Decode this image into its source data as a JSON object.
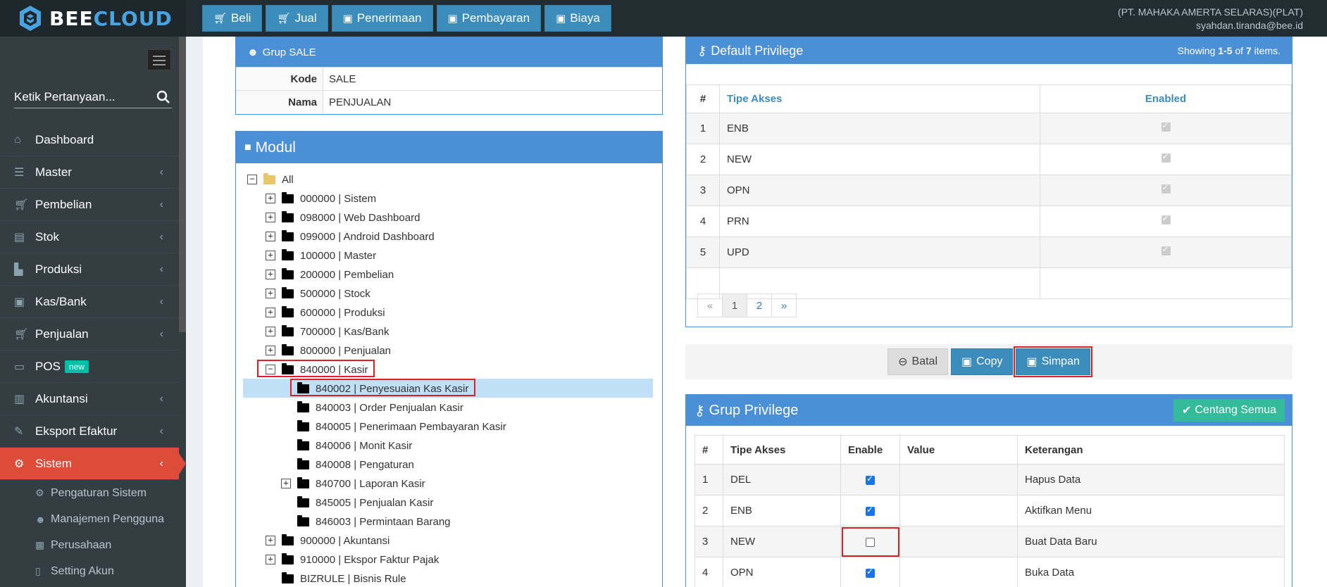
{
  "app": {
    "brand_bee": "BEE",
    "brand_cloud": "CLOUD",
    "company": "(PT. MAHAKA AMERTA SELARAS)(PLAT)",
    "user": "syahdan.tiranda@bee.id"
  },
  "topnav": [
    {
      "label": "Beli",
      "icon": "cart-icon"
    },
    {
      "label": "Jual",
      "icon": "cart-icon"
    },
    {
      "label": "Penerimaan",
      "icon": "money-icon"
    },
    {
      "label": "Pembayaran",
      "icon": "money-icon"
    },
    {
      "label": "Biaya",
      "icon": "money-icon"
    }
  ],
  "sidebar": {
    "search_placeholder": "Ketik Pertanyaan...",
    "items": [
      {
        "label": "Dashboard",
        "icon": "home-icon"
      },
      {
        "label": "Master",
        "icon": "database-icon"
      },
      {
        "label": "Pembelian",
        "icon": "cart-icon"
      },
      {
        "label": "Stok",
        "icon": "box-icon"
      },
      {
        "label": "Produksi",
        "icon": "industry-icon"
      },
      {
        "label": "Kas/Bank",
        "icon": "money-icon"
      },
      {
        "label": "Penjualan",
        "icon": "cart-icon"
      },
      {
        "label": "POS",
        "icon": "desktop-icon",
        "badge": "new"
      },
      {
        "label": "Akuntansi",
        "icon": "chart-icon"
      },
      {
        "label": "Eksport Efaktur",
        "icon": "edit-icon"
      },
      {
        "label": "Sistem",
        "icon": "cogs-icon"
      }
    ],
    "subitems": [
      {
        "label": "Pengaturan Sistem",
        "icon": "gear-icon"
      },
      {
        "label": "Manajemen Pengguna",
        "icon": "users-icon"
      },
      {
        "label": "Perusahaan",
        "icon": "building-icon"
      },
      {
        "label": "Setting Akun",
        "icon": "file-icon"
      }
    ]
  },
  "grup": {
    "title": "Grup SALE",
    "kode_label": "Kode",
    "kode_value": "SALE",
    "nama_label": "Nama",
    "nama_value": "PENJUALAN"
  },
  "modul": {
    "title": "Modul",
    "tree": [
      {
        "label": "All",
        "level": 0,
        "toggle": "−",
        "folder": "yellow"
      },
      {
        "label": "000000 | Sistem",
        "level": 1,
        "toggle": "+"
      },
      {
        "label": "098000 | Web Dashboard",
        "level": 1,
        "toggle": "+"
      },
      {
        "label": "099000 | Android Dashboard",
        "level": 1,
        "toggle": "+"
      },
      {
        "label": "100000 | Master",
        "level": 1,
        "toggle": "+"
      },
      {
        "label": "200000 | Pembelian",
        "level": 1,
        "toggle": "+"
      },
      {
        "label": "500000 | Stock",
        "level": 1,
        "toggle": "+"
      },
      {
        "label": "600000 | Produksi",
        "level": 1,
        "toggle": "+"
      },
      {
        "label": "700000 | Kas/Bank",
        "level": 1,
        "toggle": "+"
      },
      {
        "label": "800000 | Penjualan",
        "level": 1,
        "toggle": "+"
      },
      {
        "label": "840000 | Kasir",
        "level": 1,
        "toggle": "−",
        "open": true
      },
      {
        "label": "840002 | Penyesuaian Kas Kasir",
        "level": 2,
        "selected": true
      },
      {
        "label": "840003 | Order Penjualan Kasir",
        "level": 2
      },
      {
        "label": "840005 | Penerimaan Pembayaran Kasir",
        "level": 2
      },
      {
        "label": "840006 | Monit Kasir",
        "level": 2
      },
      {
        "label": "840008 | Pengaturan",
        "level": 2
      },
      {
        "label": "840700 | Laporan Kasir",
        "level": 2,
        "toggle": "+"
      },
      {
        "label": "845005 | Penjualan Kasir",
        "level": 2
      },
      {
        "label": "846003 | Permintaan Barang",
        "level": 2
      },
      {
        "label": "900000 | Akuntansi",
        "level": 1,
        "toggle": "+"
      },
      {
        "label": "910000 | Ekspor Faktur Pajak",
        "level": 1,
        "toggle": "+"
      },
      {
        "label": "BIZRULE | Bisnis Rule",
        "level": 1
      }
    ]
  },
  "default_privilege": {
    "title": "Default Privilege",
    "showing_prefix": "Showing ",
    "showing_range": "1-5",
    "showing_of": " of ",
    "showing_total": "7",
    "showing_suffix": " items.",
    "headers": {
      "num": "#",
      "tipe": "Tipe Akses",
      "enabled": "Enabled"
    },
    "rows": [
      {
        "num": "1",
        "tipe": "ENB"
      },
      {
        "num": "2",
        "tipe": "NEW"
      },
      {
        "num": "3",
        "tipe": "OPN"
      },
      {
        "num": "4",
        "tipe": "PRN"
      },
      {
        "num": "5",
        "tipe": "UPD"
      }
    ],
    "pager": {
      "prev": "«",
      "p1": "1",
      "p2": "2",
      "next": "»"
    }
  },
  "actions": {
    "batal": "Batal",
    "copy": "Copy",
    "simpan": "Simpan"
  },
  "grup_privilege": {
    "title": "Grup Privilege",
    "centang_label": "Centang Semua",
    "headers": {
      "num": "#",
      "tipe": "Tipe Akses",
      "enable": "Enable",
      "value": "Value",
      "keterangan": "Keterangan"
    },
    "rows": [
      {
        "num": "1",
        "tipe": "DEL",
        "enabled": true,
        "value": "",
        "keterangan": "Hapus Data"
      },
      {
        "num": "2",
        "tipe": "ENB",
        "enabled": true,
        "value": "",
        "keterangan": "Aktifkan Menu"
      },
      {
        "num": "3",
        "tipe": "NEW",
        "enabled": false,
        "value": "",
        "keterangan": "Buat Data Baru"
      },
      {
        "num": "4",
        "tipe": "OPN",
        "enabled": true,
        "value": "",
        "keterangan": "Buka Data"
      }
    ]
  },
  "colors": {
    "primary": "#3c8dbc",
    "header_blue": "#4b8fd6",
    "active_red": "#dd4b39",
    "sidebar": "#343d42",
    "topbar": "#222d32",
    "success": "#33bb9a",
    "badge": "#00c0a8"
  }
}
